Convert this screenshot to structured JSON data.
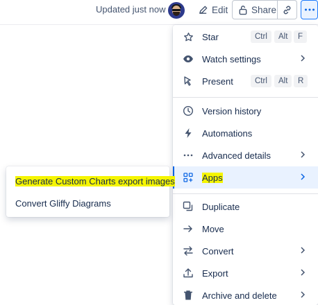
{
  "topbar": {
    "updated_text": "Updated just now",
    "edit_label": "Edit",
    "share_label": "Share"
  },
  "colors": {
    "accent": "#0c66e4",
    "highlight": "#f5f500",
    "active_bg": "#e9f2ff"
  },
  "menu": {
    "star": {
      "label": "Star",
      "shortcut": [
        "Ctrl",
        "Alt",
        "F"
      ],
      "icon": "star-icon"
    },
    "watch": {
      "label": "Watch settings",
      "icon": "eye-icon"
    },
    "present": {
      "label": "Present",
      "shortcut": [
        "Ctrl",
        "Alt",
        "R"
      ],
      "icon": "present-icon"
    },
    "version_history": {
      "label": "Version history",
      "icon": "clock-icon"
    },
    "automations": {
      "label": "Automations",
      "icon": "lightning-icon"
    },
    "advanced_details": {
      "label": "Advanced details",
      "icon": "ellipsis-icon"
    },
    "apps": {
      "label": "Apps",
      "icon": "apps-grid-icon"
    },
    "duplicate": {
      "label": "Duplicate",
      "icon": "duplicate-icon"
    },
    "move": {
      "label": "Move",
      "icon": "arrow-right-icon"
    },
    "convert": {
      "label": "Convert",
      "icon": "swap-arrows-icon"
    },
    "export": {
      "label": "Export",
      "icon": "upload-icon"
    },
    "archive_delete": {
      "label": "Archive and delete",
      "icon": "trash-icon"
    }
  },
  "submenu": {
    "items": [
      {
        "label": "Generate Custom Charts export images"
      },
      {
        "label": "Convert Gliffy Diagrams"
      }
    ]
  }
}
